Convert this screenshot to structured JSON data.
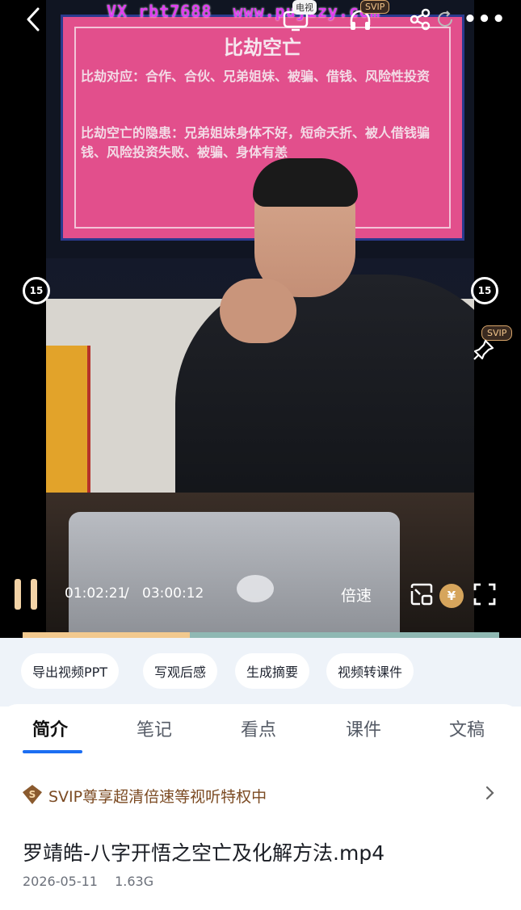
{
  "watermark": "VX rbt7688  www.pujizy.com",
  "topbar": {
    "tv_tag": "电视",
    "svip_tag": "SVIP",
    "more_label": "•••"
  },
  "video": {
    "slide_title": "比劫空亡",
    "slide_line1": "比劫对应：合作、合伙、兄弟姐妹、被骗、借钱、风险性投资",
    "slide_line2": "比劫空亡的隐患：兄弟姐妹身体不好，短命夭折、被人借钱骗钱、风险投资失败、被骗、身体有恙",
    "skip_back_label": "15",
    "skip_forward_label": "15",
    "svip_pin_label": "SVIP",
    "current_time": "01:02:21",
    "time_separator": "/",
    "duration": "03:00:12",
    "speed_label": "倍速",
    "coin_label": "¥",
    "progress_fraction": 0.35
  },
  "chips": [
    "导出视频PPT",
    "写观后感",
    "生成摘要",
    "视频转课件"
  ],
  "tabs": [
    "简介",
    "笔记",
    "看点",
    "课件",
    "文稿"
  ],
  "svip_promo": {
    "badge": "S",
    "text": "SVIP尊享超清倍速等视听特权中"
  },
  "file": {
    "title": "罗靖皓-八字开悟之空亡及化解方法.mp4",
    "date": "2026-05-11",
    "size": "1.63G"
  },
  "colors": {
    "accent": "#1c6ef2",
    "progress_fill": "#f2c98e",
    "svip_brown": "#7b4a22",
    "watermark": "#e03cf0"
  }
}
